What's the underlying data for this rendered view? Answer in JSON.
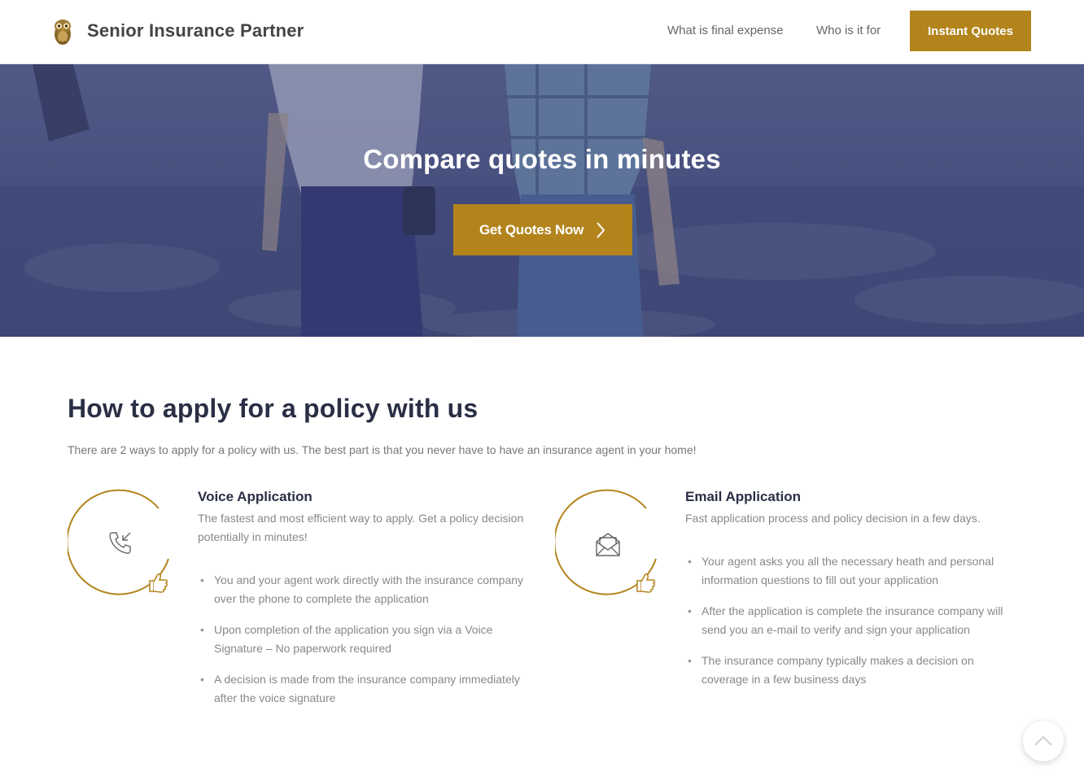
{
  "header": {
    "brand": "Senior Insurance Partner",
    "logo_icon": "owl-icon",
    "nav": [
      {
        "label": "What is final expense"
      },
      {
        "label": "Who is it for"
      }
    ],
    "cta_label": "Instant Quotes"
  },
  "hero": {
    "title": "Compare quotes in minutes",
    "button_label": "Get Quotes Now",
    "button_icon": "chevron-right-icon"
  },
  "section": {
    "title": "How to apply for a policy with us",
    "intro": "There are 2 ways to apply for a policy with us. The best part is that you never have to have an insurance agent in your home!"
  },
  "methods": [
    {
      "icon": "phone-incoming-icon",
      "badge_icon": "thumbs-up-icon",
      "title": "Voice Application",
      "description": "The fastest and most efficient way to apply. Get a policy decision potentially in minutes!",
      "items": [
        "You and your agent work directly with the insurance company over the phone to complete the application",
        "Upon completion of the application you sign via a Voice Signature – No paperwork required",
        "A decision is made from the insurance company immediately after the voice signature"
      ]
    },
    {
      "icon": "envelope-open-icon",
      "badge_icon": "thumbs-up-icon",
      "title": "Email Application",
      "description": "Fast application process and policy decision in a few days.",
      "items": [
        " Your agent asks you all the necessary heath and personal information questions to fill out your application",
        "After the application is complete the insurance company will send you an e-mail to verify and sign your application",
        "The insurance company typically makes a decision on coverage in a few business days"
      ]
    }
  ],
  "scroll_top_icon": "chevron-up-icon",
  "colors": {
    "accent": "#b3841c",
    "heading": "#2a2f45",
    "hero_overlay": "#3d4575"
  }
}
